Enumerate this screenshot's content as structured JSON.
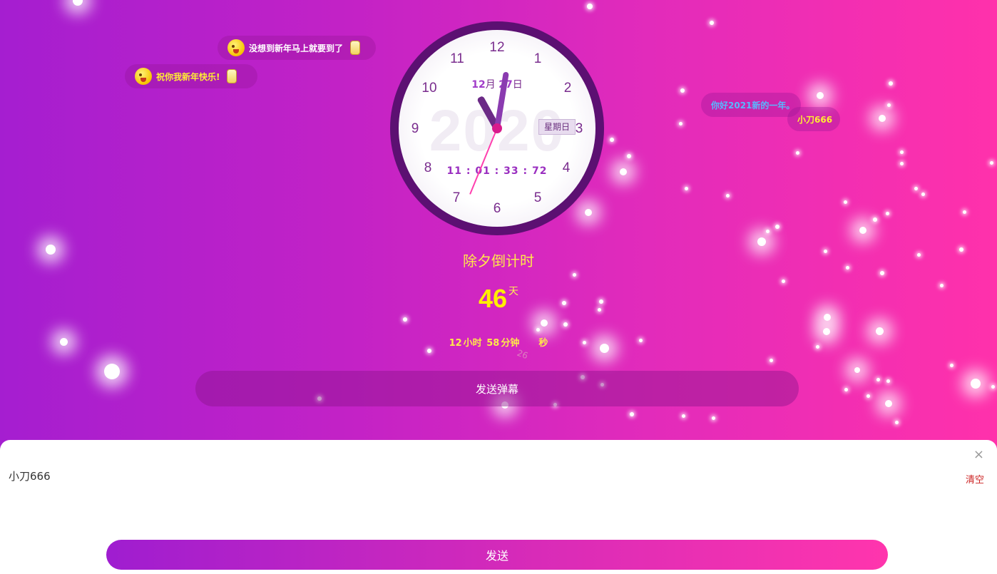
{
  "danmaku": [
    {
      "text": "没想到新年马上就要到了",
      "style": "white",
      "emoji": true,
      "lantern": true
    },
    {
      "text": "祝你我新年快乐!",
      "style": "yellow",
      "emoji": true,
      "lantern": true
    },
    {
      "text": "你好2021新的一年。",
      "style": "blue",
      "emoji": false,
      "lantern": false
    },
    {
      "text": "小刀666",
      "style": "yellow",
      "emoji": false,
      "lantern": false
    }
  ],
  "clock": {
    "numbers": [
      "12",
      "1",
      "2",
      "3",
      "4",
      "5",
      "6",
      "7",
      "8",
      "9",
      "10",
      "11"
    ],
    "year_watermark": "2020",
    "month": "12",
    "month_unit": "月",
    "day": "27",
    "day_unit": "日",
    "weekday": "星期日",
    "digital_time": "11 : 01 : 33 : 72",
    "hour_value": 11.03,
    "minute_value": 1.55,
    "second_value": 33.72
  },
  "countdown": {
    "title": "除夕倒计时",
    "days": "46",
    "days_unit": "天",
    "hours": "12",
    "hours_unit": "小时",
    "minutes": "58",
    "minutes_unit": "分钟",
    "seconds_unit": "秒",
    "falling_seconds": "26"
  },
  "send_danmaku_button": "发送弹幕",
  "input_panel": {
    "input_value": "小刀666",
    "clear_label": "清空",
    "close_icon": "×",
    "send_label": "发送"
  },
  "colors": {
    "bg_start": "#a51ed0",
    "bg_end": "#ff31ab",
    "countdown_yellow": "#ffee00",
    "clock_ring": "#5c1072"
  }
}
